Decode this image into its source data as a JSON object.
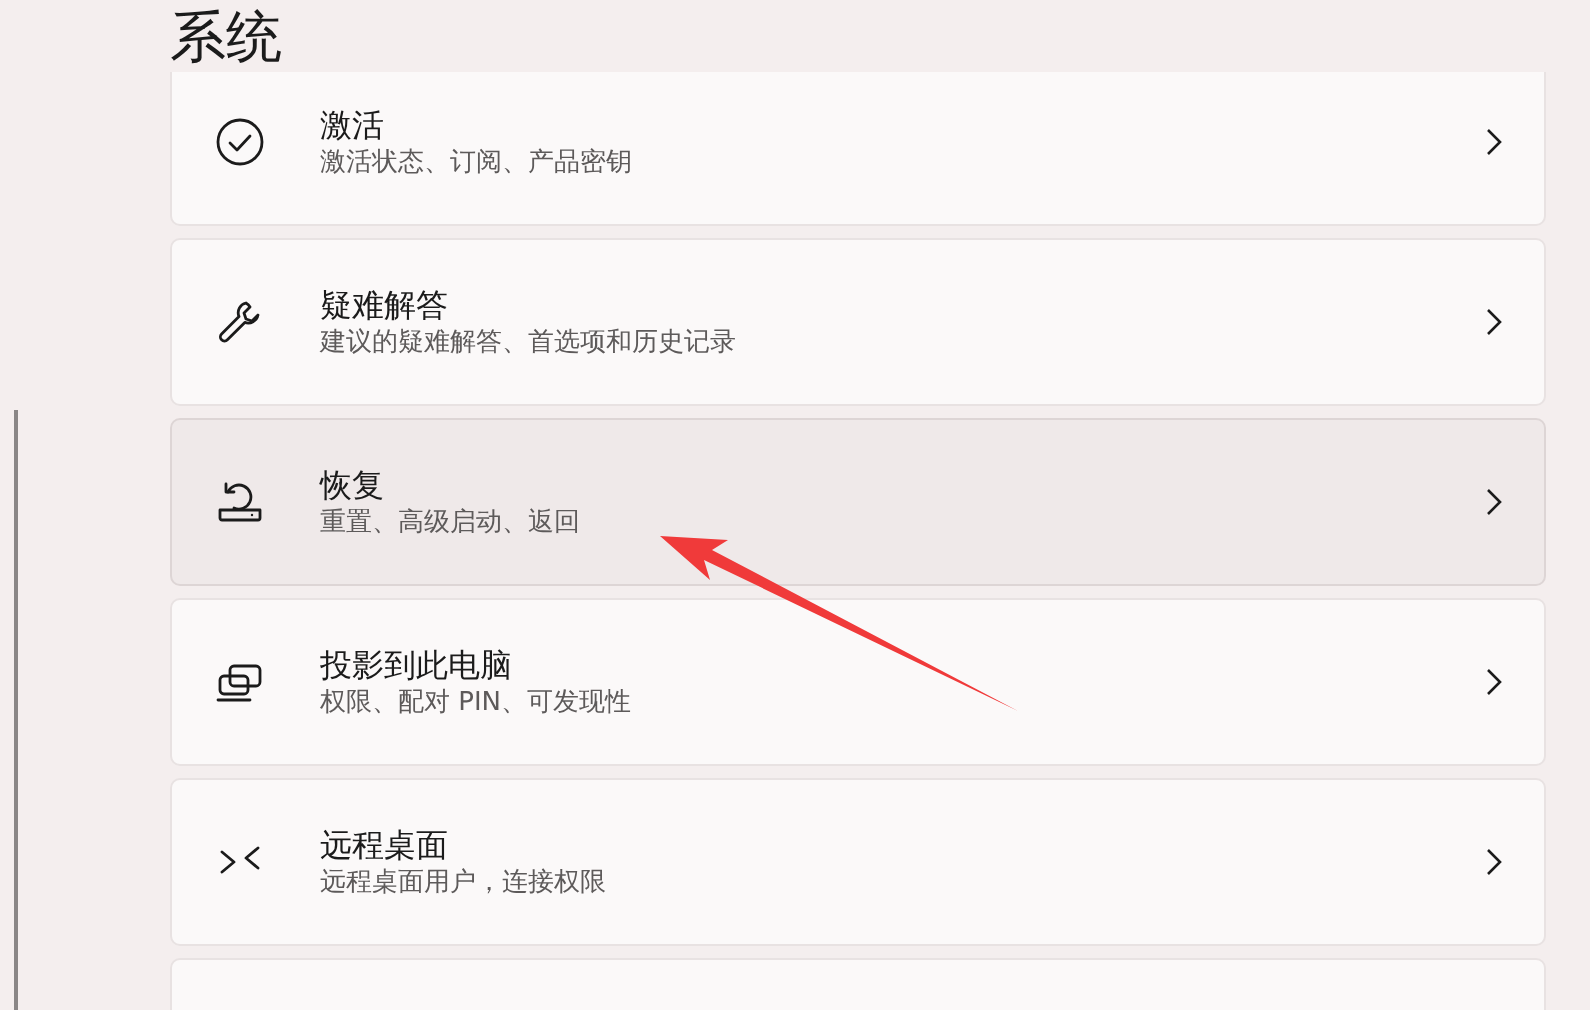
{
  "page_title": "系统",
  "items": [
    {
      "title": "激活",
      "subtitle": "激活状态、订阅、产品密钥",
      "hovered": false
    },
    {
      "title": "疑难解答",
      "subtitle": "建议的疑难解答、首选项和历史记录",
      "hovered": false
    },
    {
      "title": "恢复",
      "subtitle": "重置、高级启动、返回",
      "hovered": true
    },
    {
      "title": "投影到此电脑",
      "subtitle": "权限、配对 PIN、可发现性",
      "hovered": false
    },
    {
      "title": "远程桌面",
      "subtitle": "远程桌面用户，连接权限",
      "hovered": false
    }
  ],
  "annotation": {
    "kind": "arrow",
    "color": "#f03a3a"
  }
}
